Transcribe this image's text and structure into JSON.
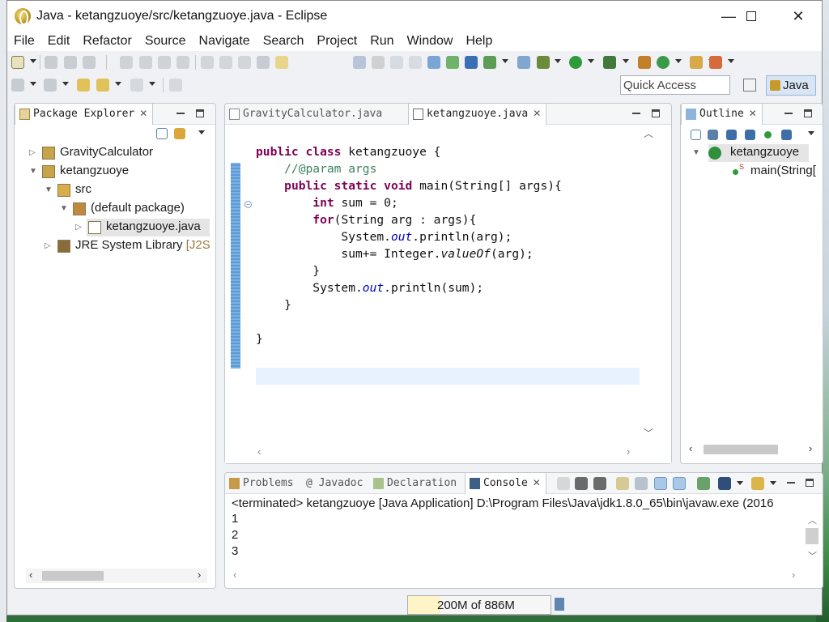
{
  "window": {
    "title": "Java - ketangzuoye/src/ketangzuoye.java - Eclipse",
    "minimize": "—",
    "close": "✕"
  },
  "menu": [
    "File",
    "Edit",
    "Refactor",
    "Source",
    "Navigate",
    "Search",
    "Project",
    "Run",
    "Window",
    "Help"
  ],
  "toolbar": {
    "quick_access_placeholder": "Quick Access",
    "perspective": "Java"
  },
  "package_explorer": {
    "tab_label": "Package Explorer",
    "tree": [
      {
        "label": "GravityCalculator",
        "depth": 0,
        "expanded": false,
        "icon": "java-project-icon"
      },
      {
        "label": "ketangzuoye",
        "depth": 0,
        "expanded": true,
        "icon": "java-project-icon"
      },
      {
        "label": "src",
        "depth": 1,
        "expanded": true,
        "icon": "source-folder-icon"
      },
      {
        "label": "(default package)",
        "depth": 2,
        "expanded": true,
        "icon": "package-icon"
      },
      {
        "label": "ketangzuoye.java",
        "depth": 3,
        "expanded": false,
        "icon": "java-file-icon",
        "selected": true
      },
      {
        "label": "JRE System Library",
        "suffix": "[J2S",
        "depth": 1,
        "expanded": false,
        "icon": "library-icon"
      }
    ]
  },
  "editor": {
    "tabs": [
      {
        "label": "GravityCalculator.java",
        "active": false
      },
      {
        "label": "ketangzuoye.java",
        "active": true
      }
    ],
    "code": [
      [
        {
          "t": "public class",
          "c": "kw"
        },
        {
          "t": " ketangzuoye {",
          "c": ""
        }
      ],
      [
        {
          "t": "    //@param args",
          "c": "cm"
        }
      ],
      [
        {
          "t": "    ",
          "c": ""
        },
        {
          "t": "public static void",
          "c": "kw"
        },
        {
          "t": " main(String[] args){",
          "c": ""
        }
      ],
      [
        {
          "t": "        ",
          "c": ""
        },
        {
          "t": "int",
          "c": "kw"
        },
        {
          "t": " sum = 0;",
          "c": ""
        }
      ],
      [
        {
          "t": "        ",
          "c": ""
        },
        {
          "t": "for",
          "c": "kw"
        },
        {
          "t": "(String arg : args){",
          "c": ""
        }
      ],
      [
        {
          "t": "            System.",
          "c": ""
        },
        {
          "t": "out",
          "c": "fi"
        },
        {
          "t": ".println(arg);",
          "c": ""
        }
      ],
      [
        {
          "t": "            sum+= Integer.",
          "c": ""
        },
        {
          "t": "valueOf",
          "c": "it"
        },
        {
          "t": "(arg);",
          "c": ""
        }
      ],
      [
        {
          "t": "        }",
          "c": ""
        }
      ],
      [
        {
          "t": "        System.",
          "c": ""
        },
        {
          "t": "out",
          "c": "fi"
        },
        {
          "t": ".println(sum);",
          "c": ""
        }
      ],
      [
        {
          "t": "    }",
          "c": ""
        }
      ],
      [
        {
          "t": "",
          "c": ""
        }
      ],
      [
        {
          "t": "}",
          "c": ""
        }
      ]
    ]
  },
  "outline": {
    "tab_label": "Outline",
    "class_name": "ketangzuoye",
    "method_name": "main(String["
  },
  "console": {
    "tabs": [
      "Problems",
      "@ Javadoc",
      "Declaration",
      "Console"
    ],
    "header": "<terminated> ketangzuoye [Java Application] D:\\Program Files\\Java\\jdk1.8.0_65\\bin\\javaw.exe (2016",
    "lines": [
      "1",
      "2",
      "3"
    ]
  },
  "status": {
    "heap": "200M of 886M"
  },
  "colors": {
    "keyword": "#7f0055",
    "comment": "#3f7f5f",
    "field": "#0000c0"
  }
}
